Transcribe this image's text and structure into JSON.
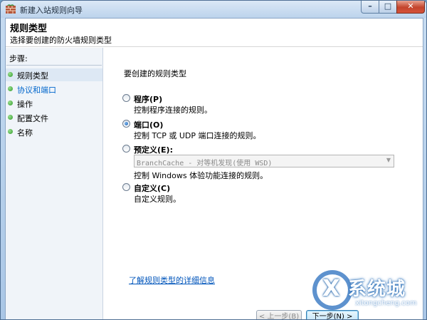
{
  "window": {
    "title": "新建入站规则向导",
    "controls": {
      "minimize_glyph": "–",
      "maximize_glyph": "□",
      "close_glyph": "✕"
    }
  },
  "header": {
    "title": "规则类型",
    "subtitle": "选择要创建的防火墙规则类型"
  },
  "sidebar": {
    "steps_title": "步骤:",
    "items": [
      {
        "label": "规则类型",
        "state": "current"
      },
      {
        "label": "协议和端口",
        "state": "link"
      },
      {
        "label": "操作",
        "state": "normal"
      },
      {
        "label": "配置文件",
        "state": "normal"
      },
      {
        "label": "名称",
        "state": "normal"
      }
    ]
  },
  "main": {
    "heading": "要创建的规则类型",
    "options": [
      {
        "label": "程序(P)",
        "desc": "控制程序连接的规则。",
        "checked": false
      },
      {
        "label": "端口(O)",
        "desc": "控制 TCP 或 UDP 端口连接的规则。",
        "checked": true
      },
      {
        "label": "预定义(E):",
        "combo_value": "BranchCache - 对等机发现(使用 WSD)",
        "desc": "控制 Windows 体验功能连接的规则。",
        "checked": false
      },
      {
        "label": "自定义(C)",
        "desc": "自定义规则。",
        "checked": false
      }
    ],
    "learn_more_link": "了解规则类型的详细信息",
    "buttons": {
      "back": "< 上一步(B)",
      "next": "下一步(N) >"
    }
  },
  "watermark": {
    "brand": "系统城",
    "url": "xitongcheng.com"
  },
  "colors": {
    "link": "#0066cc",
    "close_button": "#c3432c",
    "titlebar": "#bcd3ec"
  },
  "icons": {
    "app": "firewall-wall-icon",
    "step_marker": "green-dot-icon"
  }
}
